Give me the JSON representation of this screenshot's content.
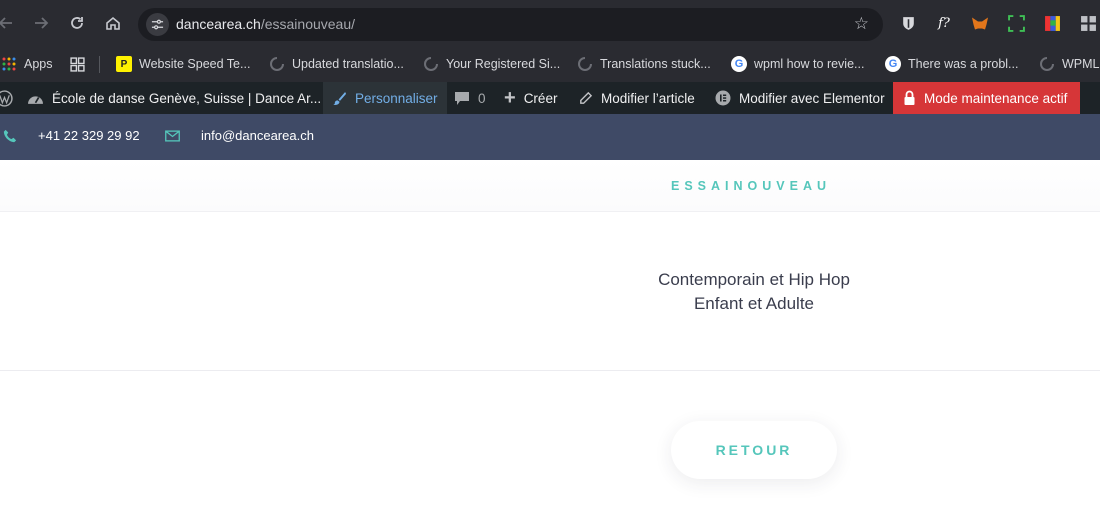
{
  "browser": {
    "url_host": "dancearea.ch",
    "url_path": "/essainouveau/",
    "bookmarks": [
      {
        "label": "Apps",
        "icon": "apps-grid-icon"
      },
      {
        "label": "",
        "icon": "all-bookmarks-icon"
      },
      {
        "label": "Website Speed Te...",
        "icon": "pingdom-icon"
      },
      {
        "label": "Updated translatio...",
        "icon": "loading-spinner-icon"
      },
      {
        "label": "Your Registered Si...",
        "icon": "loading-spinner-icon"
      },
      {
        "label": "Translations stuck...",
        "icon": "loading-spinner-icon"
      },
      {
        "label": "wpml how to revie...",
        "icon": "google-icon"
      },
      {
        "label": "There was a probl...",
        "icon": "google-icon"
      },
      {
        "label": "WPML",
        "icon": "loading-spinner-icon"
      }
    ]
  },
  "wp_admin_bar": {
    "site_name": "École de danse Genève, Suisse | Dance Ar...",
    "customize": "Personnaliser",
    "comments_count": "0",
    "new": "Créer",
    "edit_post": "Modifier l’article",
    "edit_elementor": "Modifier avec Elementor",
    "maintenance": "Mode maintenance actif"
  },
  "topbar": {
    "phone": "+41 22 329 29 92",
    "email": "info@dancearea.ch"
  },
  "page": {
    "slug_title": "ESSAINOUVEAU",
    "subtitle_line1": "Contemporain et Hip Hop",
    "subtitle_line2": "Enfant et Adulte",
    "back_button": "RETOUR"
  },
  "colors": {
    "accent_teal": "#55c6bb",
    "topbar_bg": "#3f4a66",
    "wp_bar_bg": "#1d2327",
    "maintenance_red": "#d63638"
  }
}
